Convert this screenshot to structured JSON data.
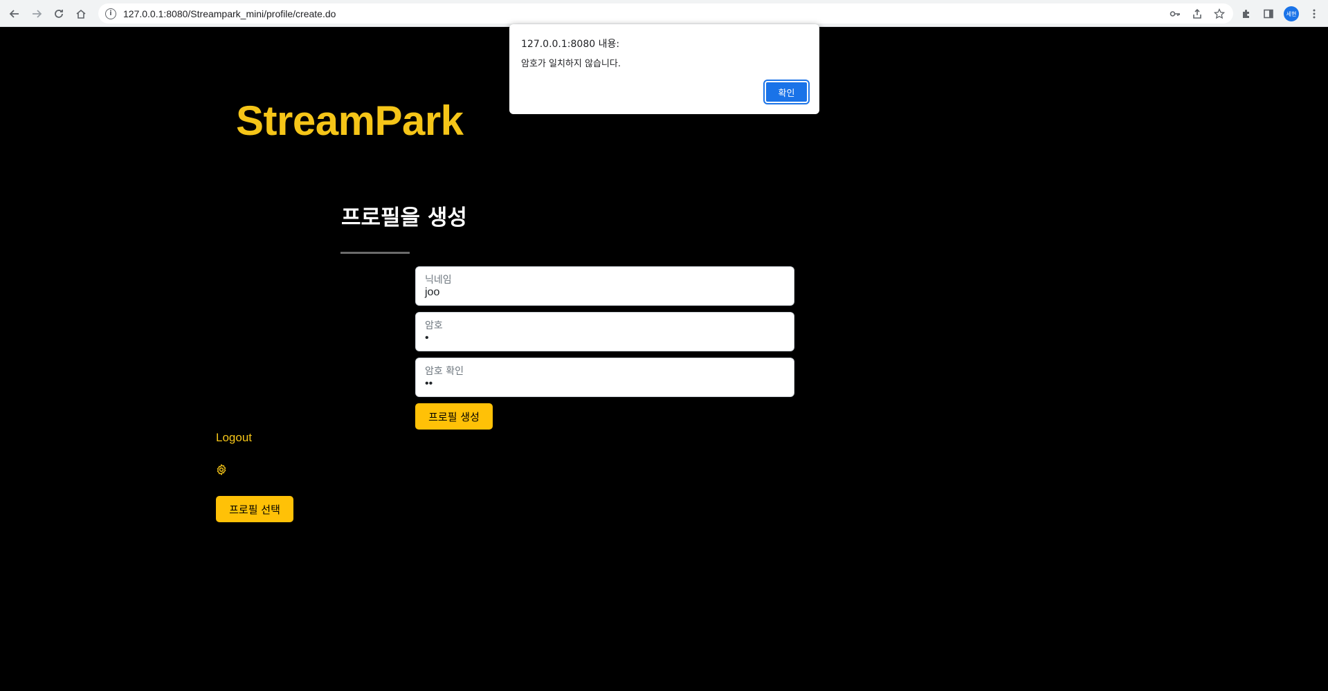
{
  "browser": {
    "url": "127.0.0.1:8080/Streampark_mini/profile/create.do",
    "profile_initials": "세현"
  },
  "page": {
    "logo": "StreamPark",
    "title": "프로필을 생성",
    "form": {
      "nickname_label": "닉네임",
      "nickname_value": "joo",
      "password_label": "암호",
      "password_value": "•",
      "confirm_label": "암호 확인",
      "confirm_value": "••",
      "submit_label": "프로필 생성"
    },
    "sidebar": {
      "logout_label": "Logout",
      "settings_icon": "gear-icon",
      "select_profile_label": "프로필 선택"
    }
  },
  "alert": {
    "title": "127.0.0.1:8080 내용:",
    "message": "암호가 일치하지 않습니다.",
    "ok_label": "확인"
  },
  "colors": {
    "accent_yellow": "#ffc107",
    "logo_yellow": "#f5c518",
    "dialog_button_blue": "#1a73e8",
    "background": "#000000"
  }
}
